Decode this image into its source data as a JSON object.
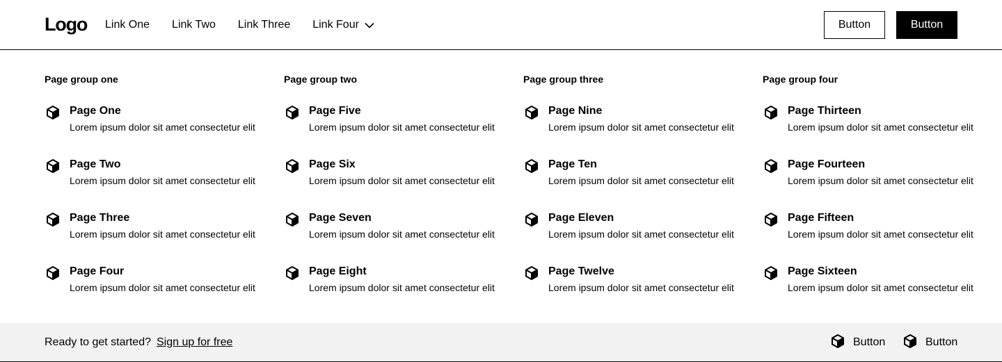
{
  "navbar": {
    "logo": "Logo",
    "links": [
      {
        "label": "Link One"
      },
      {
        "label": "Link Two"
      },
      {
        "label": "Link Three"
      }
    ],
    "dropdown_label": "Link Four",
    "dropdown_icon": "chevron-down-icon",
    "secondary_button": "Button",
    "primary_button": "Button"
  },
  "menu": {
    "groups": [
      {
        "title": "Page group one",
        "items": [
          {
            "title": "Page One",
            "description": "Lorem ipsum dolor sit amet consectetur elit",
            "icon": "cube-icon"
          },
          {
            "title": "Page Two",
            "description": "Lorem ipsum dolor sit amet consectetur elit",
            "icon": "cube-icon"
          },
          {
            "title": "Page Three",
            "description": "Lorem ipsum dolor sit amet consectetur elit",
            "icon": "cube-icon"
          },
          {
            "title": "Page Four",
            "description": "Lorem ipsum dolor sit amet consectetur elit",
            "icon": "cube-icon"
          }
        ]
      },
      {
        "title": "Page group two",
        "items": [
          {
            "title": "Page Five",
            "description": "Lorem ipsum dolor sit amet consectetur elit",
            "icon": "cube-icon"
          },
          {
            "title": "Page Six",
            "description": "Lorem ipsum dolor sit amet consectetur elit",
            "icon": "cube-icon"
          },
          {
            "title": "Page Seven",
            "description": "Lorem ipsum dolor sit amet consectetur elit",
            "icon": "cube-icon"
          },
          {
            "title": "Page Eight",
            "description": "Lorem ipsum dolor sit amet consectetur elit",
            "icon": "cube-icon"
          }
        ]
      },
      {
        "title": "Page group three",
        "items": [
          {
            "title": "Page Nine",
            "description": "Lorem ipsum dolor sit amet consectetur elit",
            "icon": "cube-icon"
          },
          {
            "title": "Page Ten",
            "description": "Lorem ipsum dolor sit amet consectetur elit",
            "icon": "cube-icon"
          },
          {
            "title": "Page Eleven",
            "description": "Lorem ipsum dolor sit amet consectetur elit",
            "icon": "cube-icon"
          },
          {
            "title": "Page Twelve",
            "description": "Lorem ipsum dolor sit amet consectetur elit",
            "icon": "cube-icon"
          }
        ]
      },
      {
        "title": "Page group four",
        "items": [
          {
            "title": "Page Thirteen",
            "description": "Lorem ipsum dolor sit amet consectetur elit",
            "icon": "cube-icon"
          },
          {
            "title": "Page Fourteen",
            "description": "Lorem ipsum dolor sit amet consectetur elit",
            "icon": "cube-icon"
          },
          {
            "title": "Page Fifteen",
            "description": "Lorem ipsum dolor sit amet consectetur elit",
            "icon": "cube-icon"
          },
          {
            "title": "Page Sixteen",
            "description": "Lorem ipsum dolor sit amet consectetur elit",
            "icon": "cube-icon"
          }
        ]
      }
    ]
  },
  "footer": {
    "prompt": "Ready to get started?",
    "signup_link": "Sign up for free",
    "buttons": [
      {
        "label": "Button",
        "icon": "cube-icon"
      },
      {
        "label": "Button",
        "icon": "cube-icon"
      }
    ],
    "background": "#f2f2f2"
  }
}
